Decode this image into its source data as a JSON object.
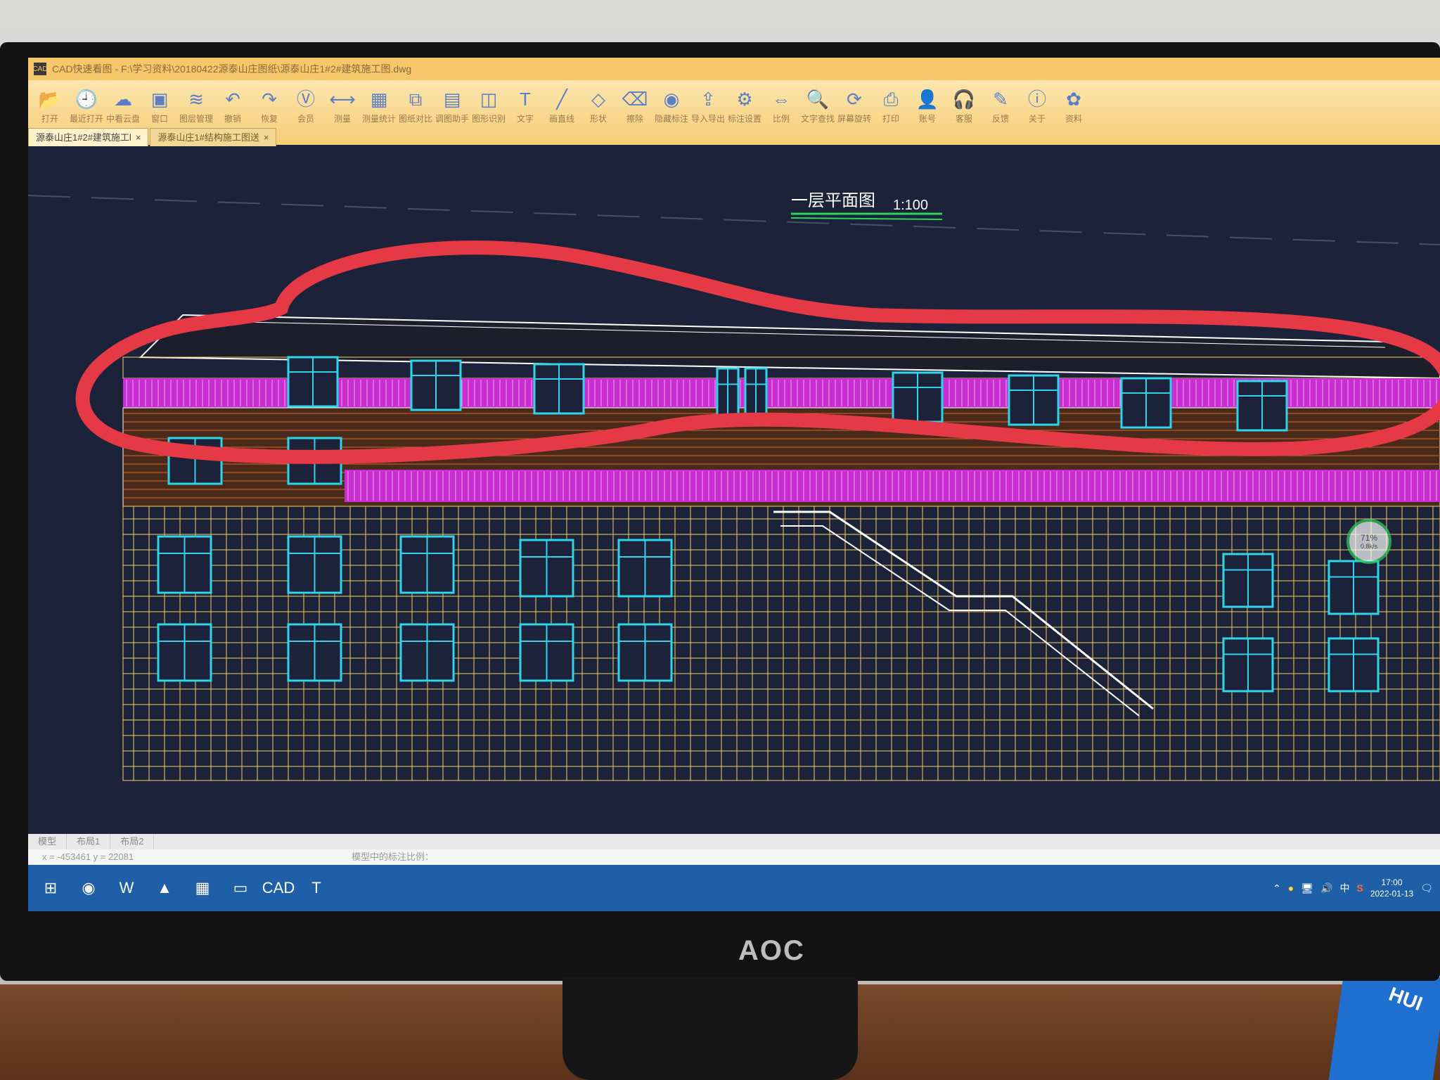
{
  "window": {
    "title": "CAD快速看图 - F:\\学习资料\\20180422源泰山庄图纸\\源泰山庄1#2#建筑施工图.dwg",
    "app_icon": "CAD"
  },
  "ribbon": {
    "tools": [
      {
        "label": "打开",
        "icon": "folder-icon",
        "glyph": "📂"
      },
      {
        "label": "最近打开",
        "icon": "history-icon",
        "glyph": "🕘"
      },
      {
        "label": "中看云盘",
        "icon": "cloud-icon",
        "glyph": "☁"
      },
      {
        "label": "窗口",
        "icon": "window-icon",
        "glyph": "▣"
      },
      {
        "label": "图层管理",
        "icon": "layers-icon",
        "glyph": "≋"
      },
      {
        "label": "撤销",
        "icon": "undo-icon",
        "glyph": "↶"
      },
      {
        "label": "恢复",
        "icon": "redo-icon",
        "glyph": "↷"
      },
      {
        "label": "会员",
        "icon": "vip-icon",
        "glyph": "Ⓥ"
      },
      {
        "label": "测量",
        "icon": "measure-icon",
        "glyph": "⟷"
      },
      {
        "label": "测量统计",
        "icon": "measure-stats-icon",
        "glyph": "▦"
      },
      {
        "label": "图纸对比",
        "icon": "compare-icon",
        "glyph": "⧉"
      },
      {
        "label": "调图助手",
        "icon": "assistant-icon",
        "glyph": "▤"
      },
      {
        "label": "图形识别",
        "icon": "recognize-icon",
        "glyph": "◫"
      },
      {
        "label": "文字",
        "icon": "text-icon",
        "glyph": "T"
      },
      {
        "label": "画直线",
        "icon": "line-icon",
        "glyph": "╱"
      },
      {
        "label": "形状",
        "icon": "shape-icon",
        "glyph": "◇"
      },
      {
        "label": "擦除",
        "icon": "eraser-icon",
        "glyph": "⌫"
      },
      {
        "label": "隐藏标注",
        "icon": "hide-icon",
        "glyph": "◉"
      },
      {
        "label": "导入导出",
        "icon": "export-icon",
        "glyph": "⇪"
      },
      {
        "label": "标注设置",
        "icon": "annotation-settings-icon",
        "glyph": "⚙"
      },
      {
        "label": "比例",
        "icon": "scale-icon",
        "glyph": "⇔"
      },
      {
        "label": "文字查找",
        "icon": "text-search-icon",
        "glyph": "🔍"
      },
      {
        "label": "屏幕旋转",
        "icon": "rotate-icon",
        "glyph": "⟳"
      },
      {
        "label": "打印",
        "icon": "print-icon",
        "glyph": "⎙"
      },
      {
        "label": "账号",
        "icon": "account-icon",
        "glyph": "👤"
      },
      {
        "label": "客服",
        "icon": "support-icon",
        "glyph": "🎧"
      },
      {
        "label": "反馈",
        "icon": "feedback-icon",
        "glyph": "✎"
      },
      {
        "label": "关于",
        "icon": "about-icon",
        "glyph": "ⓘ"
      },
      {
        "label": "资料",
        "icon": "materials-icon",
        "glyph": "✿"
      }
    ]
  },
  "tabs": [
    {
      "label": "源泰山庄1#2#建筑施工l",
      "active": true
    },
    {
      "label": "源泰山庄1#结构施工图送",
      "active": false
    }
  ],
  "drawing": {
    "title": "一层平面图",
    "scale": "1:100",
    "annotation_color": "#e63946"
  },
  "layout_tabs": [
    "模型",
    "布局1",
    "布局2"
  ],
  "status": {
    "coords": "x = -453461  y = 22081",
    "message": "模型中的标注比例："
  },
  "progress": {
    "label": "71%",
    "sub": "0.8k/s",
    "value": 71
  },
  "taskbar": {
    "apps": [
      {
        "name": "start-icon",
        "glyph": "⊞"
      },
      {
        "name": "browser-icon",
        "glyph": "◉"
      },
      {
        "name": "wps-icon",
        "glyph": "W"
      },
      {
        "name": "pdf-icon",
        "glyph": "▲"
      },
      {
        "name": "apps-icon",
        "glyph": "▦"
      },
      {
        "name": "explorer-icon",
        "glyph": "▭"
      },
      {
        "name": "cad-icon",
        "glyph": "CAD"
      },
      {
        "name": "text-app-icon",
        "glyph": "T"
      }
    ],
    "tray_lang": "中",
    "ime_lang": "中",
    "time": "17:00",
    "date": "2022-01-13"
  },
  "monitor": {
    "brand": "AOC"
  },
  "bag_text": "HUI"
}
